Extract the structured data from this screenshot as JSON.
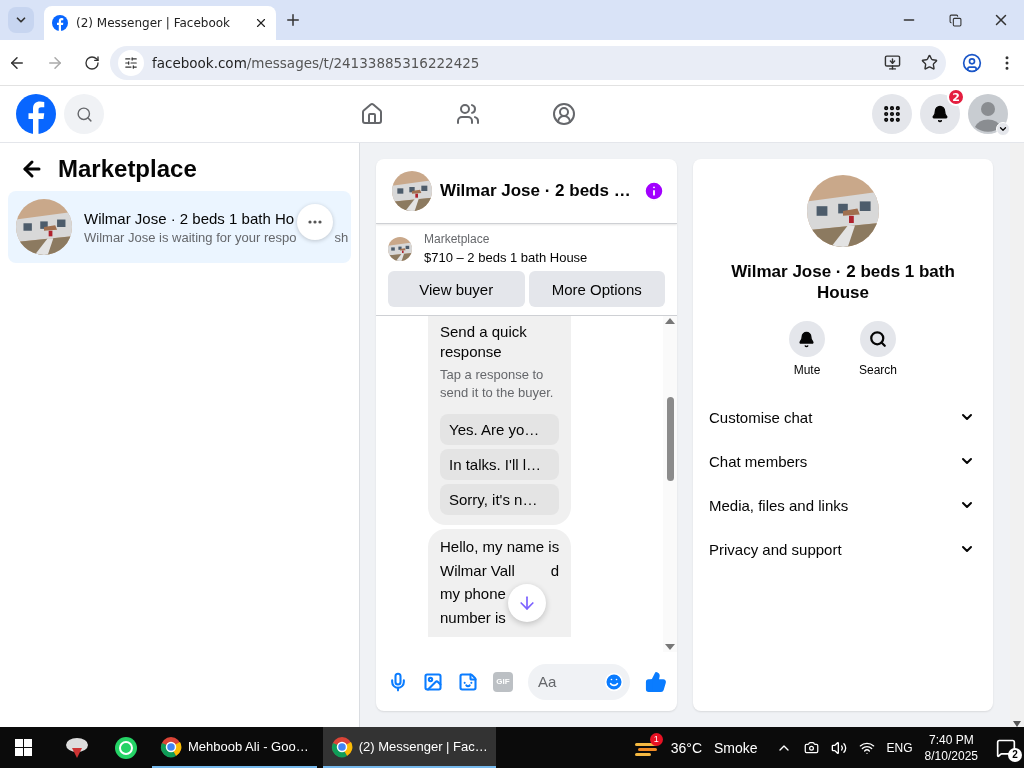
{
  "browser": {
    "tab_title": "(2) Messenger | Facebook",
    "url_domain": "facebook.com",
    "url_path": "/messages/t/24133885316222425"
  },
  "header": {
    "notification_count": "2"
  },
  "left_panel": {
    "title": "Marketplace",
    "conversations": [
      {
        "title": "Wilmar Jose · 2 beds 1 bath Ho",
        "subtitle": "Wilmar Jose is waiting for your respo",
        "subtitle_tail": "sh",
        "selected": true
      }
    ]
  },
  "chat": {
    "title": "Wilmar Jose · 2 beds …",
    "listing": {
      "source": "Marketplace",
      "summary": "$710 – 2 beds 1 bath House"
    },
    "buttons": [
      "View buyer",
      "More Options"
    ],
    "quick_response": {
      "title": "Send a quick response",
      "hint": "Tap a response to send it to the buyer.",
      "options": [
        "Yes. Are yo…",
        "In talks. I'll l…",
        "Sorry, it's n…"
      ]
    },
    "message_lines": [
      {
        "parts": [
          "Hello, my name is"
        ]
      },
      {
        "parts": [
          "Wilmar Vall",
          "d"
        ]
      },
      {
        "parts": [
          "my phone"
        ]
      },
      {
        "parts": [
          "number is"
        ]
      }
    ],
    "composer": {
      "gif_label": "GIF",
      "placeholder": "Aa"
    }
  },
  "details": {
    "title": "Wilmar Jose · 2 beds 1 bath House",
    "actions": [
      {
        "kind": "mute",
        "label": "Mute"
      },
      {
        "kind": "search",
        "label": "Search"
      }
    ],
    "sections": [
      {
        "label": "Customise chat",
        "expanded": false
      },
      {
        "label": "Chat members",
        "expanded": false
      },
      {
        "label": "Media, files and links",
        "expanded": false
      },
      {
        "label": "Privacy and support",
        "expanded": false
      }
    ]
  },
  "taskbar": {
    "tasks": [
      {
        "label": "Mehboob Ali - Goo…",
        "selected": false
      },
      {
        "label": "(2) Messenger | Fac…",
        "selected": true
      }
    ],
    "weather_badge": "1",
    "temperature": "36°C",
    "weather": "Smoke",
    "language": "ENG",
    "time": "7:40 PM",
    "date": "8/10/2025",
    "notification_count": "2"
  }
}
